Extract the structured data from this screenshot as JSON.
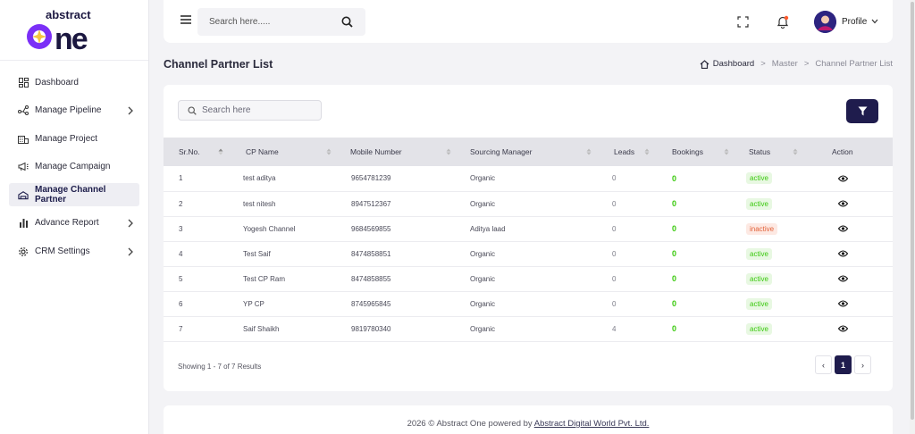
{
  "brand": {
    "logo_text_top": "abstract",
    "logo_text_main": "one",
    "colors": {
      "primary": "#1f1c4d",
      "accent_purple": "#7b2ff7",
      "success": "#3ac90e",
      "danger": "#e2623a"
    }
  },
  "sidebar": {
    "items": [
      {
        "label": "Dashboard",
        "icon": "dashboard-icon",
        "has_chevron": false,
        "active": false
      },
      {
        "label": "Manage Pipeline",
        "icon": "pipeline-icon",
        "has_chevron": true,
        "active": false
      },
      {
        "label": "Manage Project",
        "icon": "building-icon",
        "has_chevron": false,
        "active": false
      },
      {
        "label": "Manage Campaign",
        "icon": "megaphone-icon",
        "has_chevron": false,
        "active": false
      },
      {
        "label": "Manage Channel Partner",
        "icon": "partner-icon",
        "has_chevron": false,
        "active": true
      },
      {
        "label": "Advance Report",
        "icon": "bar-chart-icon",
        "has_chevron": true,
        "active": false
      },
      {
        "label": "CRM Settings",
        "icon": "gear-icon",
        "has_chevron": true,
        "active": false
      }
    ]
  },
  "header": {
    "search_placeholder": "Search here.....",
    "profile_label": "Profile"
  },
  "page": {
    "title": "Channel Partner List",
    "breadcrumb": {
      "home": "Dashboard",
      "sep": ">",
      "middle": "Master",
      "current": "Channel Partner List"
    }
  },
  "table": {
    "search_placeholder": "Search here",
    "columns": [
      "Sr.No.",
      "CP Name",
      "Mobile Number",
      "Sourcing Manager",
      "Leads",
      "Bookings",
      "Status",
      "Action"
    ],
    "rows": [
      {
        "sr": "1",
        "name": "test aditya",
        "mobile": "9654781239",
        "manager": "Organic",
        "leads": "0",
        "bookings": "0",
        "status": "active"
      },
      {
        "sr": "2",
        "name": "test nitesh",
        "mobile": "8947512367",
        "manager": "Organic",
        "leads": "0",
        "bookings": "0",
        "status": "active"
      },
      {
        "sr": "3",
        "name": "Yogesh Channel",
        "mobile": "9684569855",
        "manager": "Aditya laad",
        "leads": "0",
        "bookings": "0",
        "status": "inactive"
      },
      {
        "sr": "4",
        "name": "Test Saif",
        "mobile": "8474858851",
        "manager": "Organic",
        "leads": "0",
        "bookings": "0",
        "status": "active"
      },
      {
        "sr": "5",
        "name": "Test CP Ram",
        "mobile": "8474858855",
        "manager": "Organic",
        "leads": "0",
        "bookings": "0",
        "status": "active"
      },
      {
        "sr": "6",
        "name": "YP CP",
        "mobile": "8745965845",
        "manager": "Organic",
        "leads": "0",
        "bookings": "0",
        "status": "active"
      },
      {
        "sr": "7",
        "name": "Saif Shaikh",
        "mobile": "9819780340",
        "manager": "Organic",
        "leads": "4",
        "bookings": "0",
        "status": "active"
      }
    ],
    "showing_text": "Showing 1 - 7 of 7 Results",
    "pagination": {
      "prev": "‹",
      "current": "1",
      "next": "›"
    }
  },
  "footer": {
    "text": "2026 © Abstract One powered by ",
    "link": "Abstract Digital World Pvt. Ltd."
  }
}
